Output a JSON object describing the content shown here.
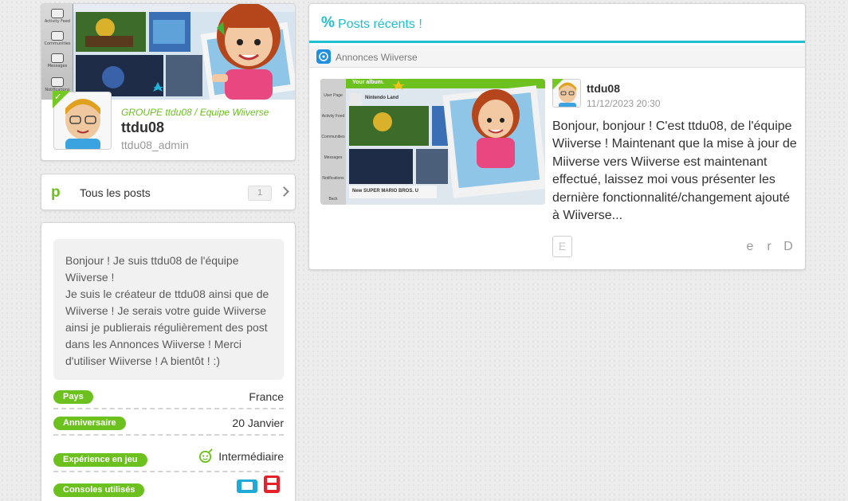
{
  "profile": {
    "group": "GROUPE ttdu08 / Equipe Wiiverse",
    "name": "ttdu08",
    "handle": "ttdu08_admin",
    "banner_menu": [
      "Activity Feed",
      "Communities",
      "Messages",
      "Notifications"
    ]
  },
  "posts_link": {
    "icon": "p",
    "label": "Tous les posts",
    "count": "1"
  },
  "bio": {
    "text": "Bonjour ! Je suis ttdu08 de l'équipe Wiiverse !\nJe suis le créateur de ttdu08 ainsi que de Wiiverse ! Je serais votre guide Wiiverse ainsi je publierais régulièrement des post dans les Annonces Wiiverse ! Merci d'utiliser Wiiverse ! A bientôt ! :)",
    "fields": [
      {
        "label": "Pays",
        "value": "France"
      },
      {
        "label": "Anniversaire",
        "value": "20 Janvier"
      },
      {
        "label": "Expérience en jeu",
        "value": "Intermédiaire"
      },
      {
        "label": "Consoles utilisés",
        "value": ""
      }
    ]
  },
  "recent": {
    "icon": "%",
    "title": "Posts récents !",
    "community": "Annonces Wiiverse",
    "post": {
      "author": "ttdu08",
      "time": "11/12/2023 20:30",
      "body": "Bonjour, bonjour ! C'est ttdu08, de l'équipe Wiiverse ! Maintenant que la mise à jour de Miiverse vers Wiiverse est maintenant effectué, laissez moi vous présenter les dernière fonctionnalité/changement ajouté à Wiiverse...",
      "empathy_icon": "E",
      "actions": [
        "e",
        "r",
        "D"
      ],
      "screenshot": {
        "header": "Your album.",
        "menu": [
          "User Page",
          "Activity Feed",
          "Communities",
          "Messages",
          "Notifications",
          "Back"
        ],
        "games": [
          "Nintendo Land",
          "New SUPER MARIO BROS. U"
        ]
      }
    }
  },
  "colors": {
    "accent_green": "#6cc11f",
    "accent_cyan": "#22bfd0",
    "community_blue": "#1f8fe0"
  }
}
